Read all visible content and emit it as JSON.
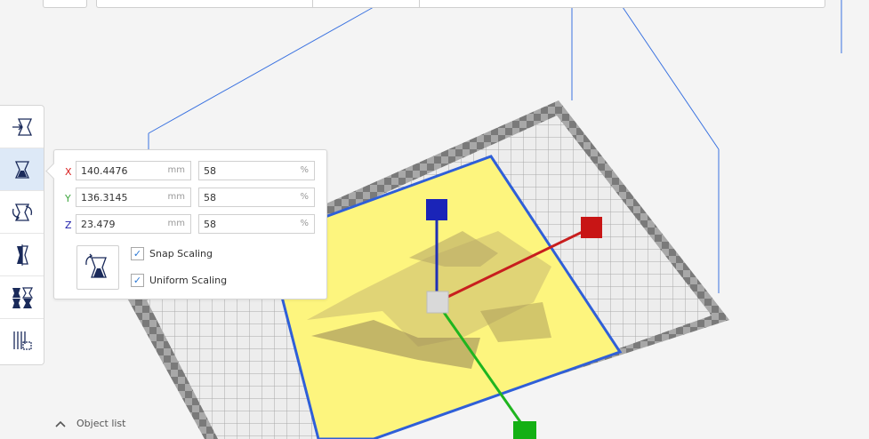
{
  "scale_panel": {
    "rows": [
      {
        "axis": "X",
        "axis_color": "#d81e1e",
        "value": "140.4476",
        "unit": "mm",
        "percent": "58",
        "percent_unit": "%"
      },
      {
        "axis": "Y",
        "axis_color": "#3ea63e",
        "value": "136.3145",
        "unit": "mm",
        "percent": "58",
        "percent_unit": "%"
      },
      {
        "axis": "Z",
        "axis_color": "#1d1daa",
        "value": "23.479",
        "unit": "mm",
        "percent": "58",
        "percent_unit": "%"
      }
    ],
    "snap_scaling": {
      "label": "Snap Scaling",
      "checked": true
    },
    "uniform_scaling": {
      "label": "Uniform Scaling",
      "checked": true
    },
    "lock_model_icon": "lock-model-icon"
  },
  "toolbar": {
    "tools": [
      {
        "name": "move-tool-icon",
        "active": false
      },
      {
        "name": "scale-tool-icon",
        "active": true
      },
      {
        "name": "rotate-tool-icon",
        "active": false
      },
      {
        "name": "mirror-tool-icon",
        "active": false
      },
      {
        "name": "per-model-settings-icon",
        "active": false
      },
      {
        "name": "support-blocker-icon",
        "active": false
      }
    ]
  },
  "object_list": {
    "label": "Object list",
    "icon": "chevron-up-icon"
  },
  "colors": {
    "accent": "#2c78d4",
    "model": "#fdf57e",
    "build_volume": "#3a72e0"
  }
}
